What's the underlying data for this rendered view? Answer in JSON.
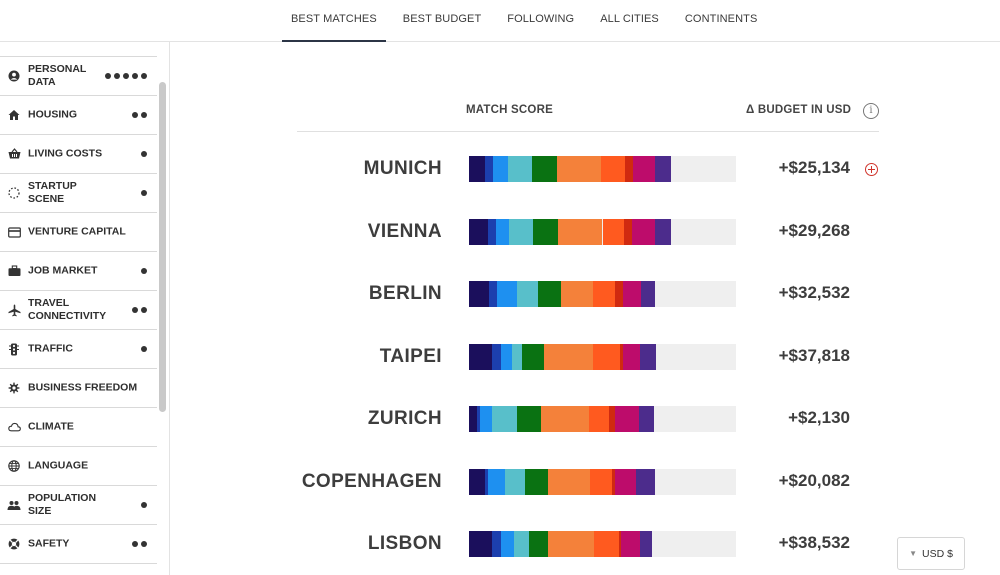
{
  "nav": {
    "tabs": [
      {
        "label": "BEST MATCHES",
        "active": true
      },
      {
        "label": "BEST BUDGET",
        "active": false
      },
      {
        "label": "FOLLOWING",
        "active": false
      },
      {
        "label": "ALL CITIES",
        "active": false
      },
      {
        "label": "CONTINENTS",
        "active": false
      }
    ]
  },
  "sidebar": {
    "items": [
      {
        "label": "PERSONAL DATA",
        "icon": "person-icon",
        "dots": 5
      },
      {
        "label": "HOUSING",
        "icon": "house-icon",
        "dots": 2
      },
      {
        "label": "LIVING COSTS",
        "icon": "basket-icon",
        "dots": 1
      },
      {
        "label": "STARTUP SCENE",
        "icon": "dotted-circle-icon",
        "dots": 1
      },
      {
        "label": "VENTURE CAPITAL",
        "icon": "card-icon",
        "dots": 0
      },
      {
        "label": "JOB MARKET",
        "icon": "briefcase-icon",
        "dots": 1
      },
      {
        "label": "TRAVEL CONNECTIVITY",
        "icon": "plane-icon",
        "dots": 2
      },
      {
        "label": "TRAFFIC",
        "icon": "traffic-light-icon",
        "dots": 1
      },
      {
        "label": "BUSINESS FREEDOM",
        "icon": "gear-icon",
        "dots": 0
      },
      {
        "label": "CLIMATE",
        "icon": "cloud-icon",
        "dots": 0
      },
      {
        "label": "LANGUAGE",
        "icon": "globe-icon",
        "dots": 0
      },
      {
        "label": "POPULATION SIZE",
        "icon": "people-icon",
        "dots": 1
      },
      {
        "label": "SAFETY",
        "icon": "lifebuoy-icon",
        "dots": 2
      }
    ]
  },
  "table": {
    "match_score_header": "MATCH SCORE",
    "budget_header": "Δ BUDGET IN USD",
    "info_icon": "i",
    "segment_colors": [
      "#1b0f5c",
      "#1c3fae",
      "#1e90f0",
      "#58bfca",
      "#0a7212",
      "#f4813a",
      "#ff5a1f",
      "#d02a10",
      "#bd0c6b",
      "#4c2c8c"
    ],
    "rows": [
      {
        "city": "MUNICH",
        "budget": "+$25,134",
        "segments": [
          0.06,
          0.03,
          0.057,
          0.09,
          0.093,
          0.163,
          0.09,
          0.03,
          0.085,
          0.06
        ],
        "add_icon": true
      },
      {
        "city": "VIENNA",
        "budget": "+$29,268",
        "segments": [
          0.07,
          0.03,
          0.05,
          0.09,
          0.095,
          0.165,
          0.08,
          0.03,
          0.085,
          0.06
        ],
        "add_icon": false
      },
      {
        "city": "BERLIN",
        "budget": "+$32,532",
        "segments": [
          0.075,
          0.03,
          0.075,
          0.08,
          0.085,
          0.12,
          0.08,
          0.03,
          0.07,
          0.05
        ],
        "add_icon": false
      },
      {
        "city": "TAIPEI",
        "budget": "+$37,818",
        "segments": [
          0.085,
          0.035,
          0.04,
          0.04,
          0.08,
          0.185,
          0.1,
          0.01,
          0.065,
          0.06
        ],
        "add_icon": false
      },
      {
        "city": "ZURICH",
        "budget": "+$2,130",
        "segments": [
          0.03,
          0.01,
          0.048,
          0.09,
          0.09,
          0.18,
          0.075,
          0.025,
          0.09,
          0.055
        ],
        "add_icon": false
      },
      {
        "city": "COPENHAGEN",
        "budget": "+$20,082",
        "segments": [
          0.06,
          0.01,
          0.065,
          0.075,
          0.085,
          0.16,
          0.08,
          0.01,
          0.08,
          0.07
        ],
        "add_icon": false
      },
      {
        "city": "LISBON",
        "budget": "+$38,532",
        "segments": [
          0.085,
          0.035,
          0.05,
          0.055,
          0.07,
          0.175,
          0.09,
          0.01,
          0.07,
          0.045
        ],
        "add_icon": false
      }
    ]
  },
  "currency": {
    "label": "USD $",
    "caret": "▼"
  }
}
